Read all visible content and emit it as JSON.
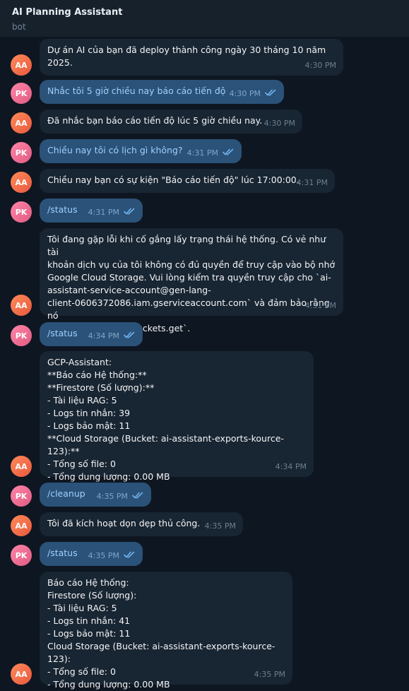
{
  "header": {
    "title": "AI Planning Assistant",
    "subtitle": "bot"
  },
  "messages": [
    {
      "sender": "AA",
      "text": "Dự án AI của bạn đã deploy thành công ngày 30 tháng 10 năm\n2025.",
      "time": "4:30 PM"
    },
    {
      "sender": "PK",
      "text": "Nhắc tôi 5 giờ chiều nay báo cáo tiến độ",
      "time": "4:30 PM"
    },
    {
      "sender": "AA",
      "text": "Đã nhắc bạn báo cáo tiến độ lúc 5 giờ chiều nay.",
      "time": "4:30 PM"
    },
    {
      "sender": "PK",
      "text": "Chiều nay tôi có lịch gì không?",
      "time": "4:31 PM"
    },
    {
      "sender": "AA",
      "text": "Chiều nay bạn có sự kiện \"Báo cáo tiến độ\" lúc 17:00:00.",
      "time": "4:31 PM"
    },
    {
      "sender": "PK",
      "text": "/status",
      "time": "4:31 PM"
    },
    {
      "sender": "AA",
      "text": "Tôi đang gặp lỗi khi cố gắng lấy trạng thái hệ thống. Có vẻ như tài\nkhoản dịch vụ của tôi không có đủ quyền để truy cập vào bộ nhớ\nGoogle Cloud Storage. Vui lòng kiểm tra quyền truy cập cho `ai-\nassistant-service-account@gen-lang-\nclient-0606372086.iam.gserviceaccount.com` và đảm bảo rằng nó\ncó quyền `storage.buckets.get`.",
      "time": "4:31 PM"
    },
    {
      "sender": "PK",
      "text": "/status",
      "time": "4:34 PM"
    },
    {
      "sender": "AA",
      "text": "GCP-Assistant:\n**Báo cáo Hệ thống:**\n**Firestore (Số lượng):**\n- Tài liệu RAG: 5\n- Logs tin nhắn: 39\n- Logs bảo mật: 11\n**Cloud Storage (Bucket: ai-assistant-exports-kource-123):**\n- Tổng số file: 0\n- Tổng dung lượng: 0.00 MB",
      "time": "4:34 PM"
    },
    {
      "sender": "PK",
      "text": "/cleanup",
      "time": "4:35 PM"
    },
    {
      "sender": "AA",
      "text": "Tôi đã kích hoạt dọn dẹp thủ công.",
      "time": "4:35 PM"
    },
    {
      "sender": "PK",
      "text": "/status",
      "time": "4:35 PM"
    },
    {
      "sender": "AA",
      "text": "Báo cáo Hệ thống:\nFirestore (Số lượng):\n- Tài liệu RAG: 5\n- Logs tin nhắn: 41\n- Logs bảo mật: 11\nCloud Storage (Bucket: ai-assistant-exports-kource-123):\n- Tổng số file: 0\n- Tổng dung lượng: 0.00 MB",
      "time": "4:35 PM"
    }
  ]
}
